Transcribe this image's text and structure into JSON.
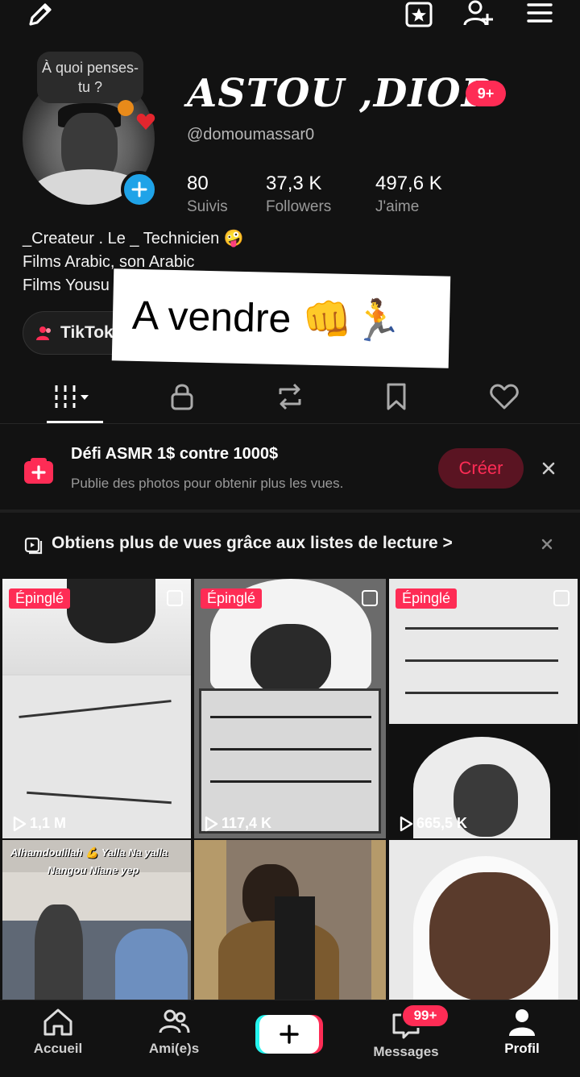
{
  "topbar": {
    "icons": [
      "edit-pencil-icon",
      "favorites-star-icon",
      "add-friend-icon",
      "menu-hamburger-icon"
    ]
  },
  "profile": {
    "thought_bubble": "À quoi penses-tu ?",
    "display_name": "ASTOU ,DIOP",
    "notif_badge": "9+",
    "username": "@domoumassar0",
    "stats": [
      {
        "value": "80",
        "label": "Suivis"
      },
      {
        "value": "37,3 K",
        "label": "Followers"
      },
      {
        "value": "497,6 K",
        "label": "J'aime"
      }
    ],
    "bio": [
      "_Createur .  Le _ Technicien 🤪",
      "Films Arabic, son Arabic",
      "Films Yousu"
    ],
    "tiktok_button": "TikTok",
    "overlay_sticker": "A vendre 👊🏃"
  },
  "tabs": [
    {
      "name": "videos",
      "icon": "grid-icon"
    },
    {
      "name": "private",
      "icon": "lock-icon"
    },
    {
      "name": "reposts",
      "icon": "repost-icon"
    },
    {
      "name": "favorites",
      "icon": "bookmark-icon"
    },
    {
      "name": "liked",
      "icon": "heart-icon"
    }
  ],
  "promo": {
    "title": "Défi ASMR 1$ contre 1000$",
    "subtitle": "Publie des photos pour obtenir plus les vues.",
    "button": "Créer"
  },
  "playlist_banner": {
    "text": "Obtiens plus de vues grâce aux listes de lecture >"
  },
  "videos": [
    {
      "pinned": "Épinglé",
      "views": "1,1 M"
    },
    {
      "pinned": "Épinglé",
      "views": "117,4 K"
    },
    {
      "pinned": "Épinglé",
      "views": "665,5 K"
    },
    {
      "caption_line1": "Alhamdoulilah 💪 Yalla Na yalla",
      "caption_line2": "Nangou Niane yep"
    },
    {},
    {}
  ],
  "bottom_nav": {
    "home": "Accueil",
    "friends": "Ami(e)s",
    "messages": "Messages",
    "messages_badge": "99+",
    "profile": "Profil"
  },
  "colors": {
    "accent": "#fe2c55",
    "background": "#121212",
    "blue": "#1fa3e8",
    "cyan": "#25f4ee"
  }
}
